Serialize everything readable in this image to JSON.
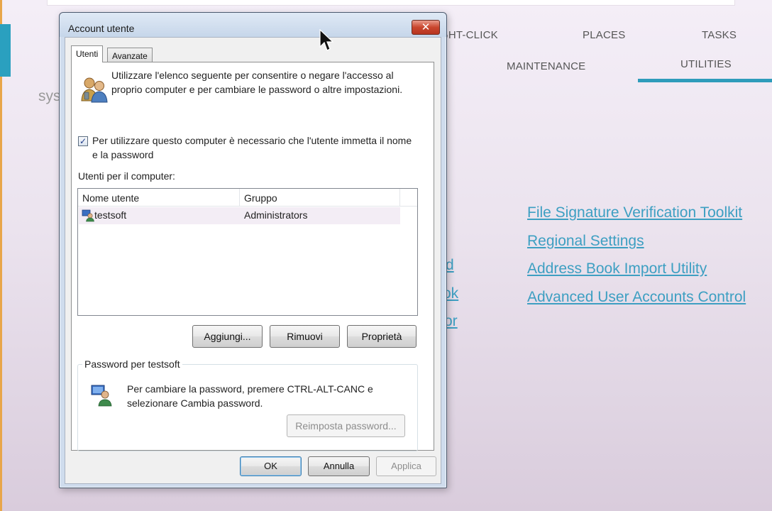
{
  "background_app": {
    "nav": {
      "right_click": "GHT-CLICK",
      "places": "PLACES",
      "tasks": "TASKS",
      "maintenance": "MAINTENANCE",
      "utilities": "UTILITIES"
    },
    "section_heading_partial": "sys",
    "partial_links": [
      "d",
      "ok",
      "or"
    ],
    "links": [
      "File Signature Verification Toolkit",
      "Regional Settings",
      "Address Book Import Utility",
      "Advanced User Accounts Control"
    ],
    "accent_color": "#2e9cbb"
  },
  "dialog": {
    "title": "Account utente",
    "close_glyph": "✕",
    "tabs": [
      {
        "label": "Utenti",
        "active": true
      },
      {
        "label": "Avanzate",
        "active": false
      }
    ],
    "description": "Utilizzare l'elenco seguente per consentire o negare l'accesso al proprio computer e per cambiare le password o altre impostazioni.",
    "require_login": {
      "checked": true,
      "label": "Per utilizzare questo computer è necessario che l'utente immetta il nome e la password"
    },
    "users_label": "Utenti per il computer:",
    "columns": [
      "Nome utente",
      "Gruppo"
    ],
    "rows": [
      {
        "name": "testsoft",
        "group": "Administrators"
      }
    ],
    "buttons": {
      "add": "Aggiungi...",
      "remove": "Rimuovi",
      "properties": "Proprietà"
    },
    "password_group": {
      "legend": "Password per testsoft",
      "text": "Per cambiare la password, premere CTRL-ALT-CANC e selezionare Cambia password.",
      "reset_button": "Reimposta password..."
    },
    "footer": {
      "ok": "OK",
      "cancel": "Annulla",
      "apply": "Applica"
    }
  }
}
